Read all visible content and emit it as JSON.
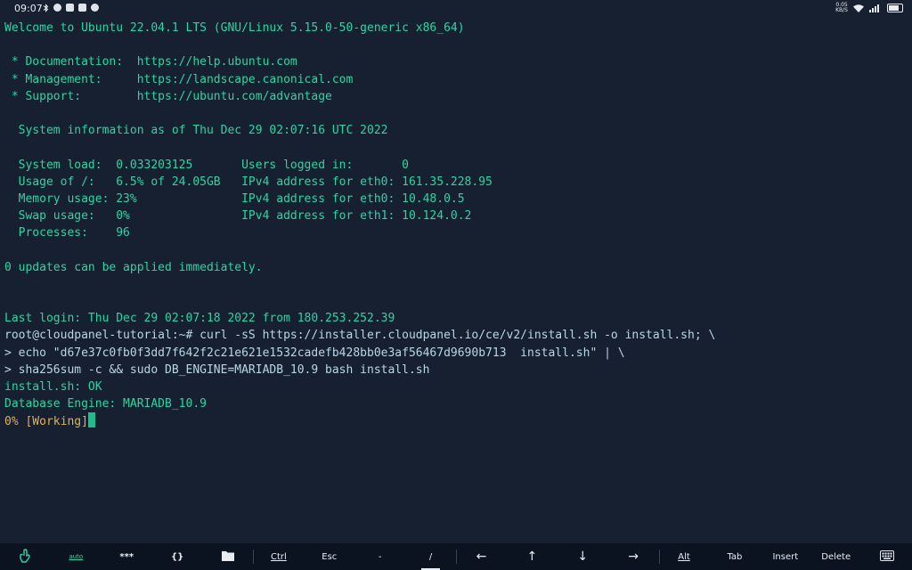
{
  "statusbar": {
    "time": "09:07",
    "net_speed_value": "0.05",
    "net_speed_unit": "KB/S",
    "icons": [
      "bluetooth-icon",
      "notification-icon",
      "notification-icon",
      "notification-icon",
      "notification-icon",
      "wifi-icon",
      "signal-icon",
      "battery-icon"
    ]
  },
  "terminal": {
    "lines": [
      {
        "text": "Welcome to Ubuntu 22.04.1 LTS (GNU/Linux 5.15.0-50-generic x86_64)",
        "style": "out"
      },
      {
        "text": "",
        "style": "out"
      },
      {
        "text": " * Documentation:  https://help.ubuntu.com",
        "style": "out"
      },
      {
        "text": " * Management:     https://landscape.canonical.com",
        "style": "out"
      },
      {
        "text": " * Support:        https://ubuntu.com/advantage",
        "style": "out"
      },
      {
        "text": "",
        "style": "out"
      },
      {
        "text": "  System information as of Thu Dec 29 02:07:16 UTC 2022",
        "style": "out"
      },
      {
        "text": "",
        "style": "out"
      },
      {
        "text": "  System load:  0.033203125       Users logged in:       0",
        "style": "out"
      },
      {
        "text": "  Usage of /:   6.5% of 24.05GB   IPv4 address for eth0: 161.35.228.95",
        "style": "out"
      },
      {
        "text": "  Memory usage: 23%               IPv4 address for eth0: 10.48.0.5",
        "style": "out"
      },
      {
        "text": "  Swap usage:   0%                IPv4 address for eth1: 10.124.0.2",
        "style": "out"
      },
      {
        "text": "  Processes:    96",
        "style": "out"
      },
      {
        "text": "",
        "style": "out"
      },
      {
        "text": "0 updates can be applied immediately.",
        "style": "out"
      },
      {
        "text": "",
        "style": "out"
      },
      {
        "text": "",
        "style": "out"
      },
      {
        "text": "Last login: Thu Dec 29 02:07:18 2022 from 180.253.252.39",
        "style": "out"
      },
      {
        "text": "root@cloudpanel-tutorial:~# curl -sS https://installer.cloudpanel.io/ce/v2/install.sh -o install.sh; \\",
        "style": "cmd"
      },
      {
        "text": "> echo \"d67e37c0fb0f3dd7f642f2c21e621e1532cadefb428bb0e3af56467d9690b713  install.sh\" | \\",
        "style": "cmd"
      },
      {
        "text": "> sha256sum -c && sudo DB_ENGINE=MARIADB_10.9 bash install.sh",
        "style": "cmd"
      },
      {
        "text": "install.sh: OK",
        "style": "out"
      },
      {
        "text": "Database Engine: MARIADB_10.9",
        "style": "out"
      },
      {
        "text": "0% [Working]",
        "style": "warn"
      }
    ]
  },
  "extra_keys": [
    {
      "kind": "icon",
      "icon": "touch-hand-icon"
    },
    {
      "kind": "text",
      "label": "auto",
      "small": true
    },
    {
      "kind": "text",
      "label": "***"
    },
    {
      "kind": "text",
      "label": "{}"
    },
    {
      "kind": "icon",
      "icon": "folder-icon"
    },
    {
      "kind": "text",
      "label": "Ctrl",
      "underline": true
    },
    {
      "kind": "text",
      "label": "Esc"
    },
    {
      "kind": "text",
      "label": "-"
    },
    {
      "kind": "text",
      "label": "/",
      "active": true
    },
    {
      "kind": "text",
      "label": "←",
      "arrow": true
    },
    {
      "kind": "text",
      "label": "↑",
      "arrow": true
    },
    {
      "kind": "text",
      "label": "↓",
      "arrow": true
    },
    {
      "kind": "text",
      "label": "→",
      "arrow": true
    },
    {
      "kind": "text",
      "label": "Alt",
      "underline": true
    },
    {
      "kind": "text",
      "label": "Tab"
    },
    {
      "kind": "text",
      "label": "Insert"
    },
    {
      "kind": "text",
      "label": "Delete"
    },
    {
      "kind": "icon",
      "icon": "keyboard-icon"
    }
  ],
  "colors": {
    "background": "#162030",
    "output_text": "#2bd6a2",
    "command_text": "#b9d6e6",
    "working_text": "#ddb25a",
    "cursor": "#1dbe8a"
  }
}
